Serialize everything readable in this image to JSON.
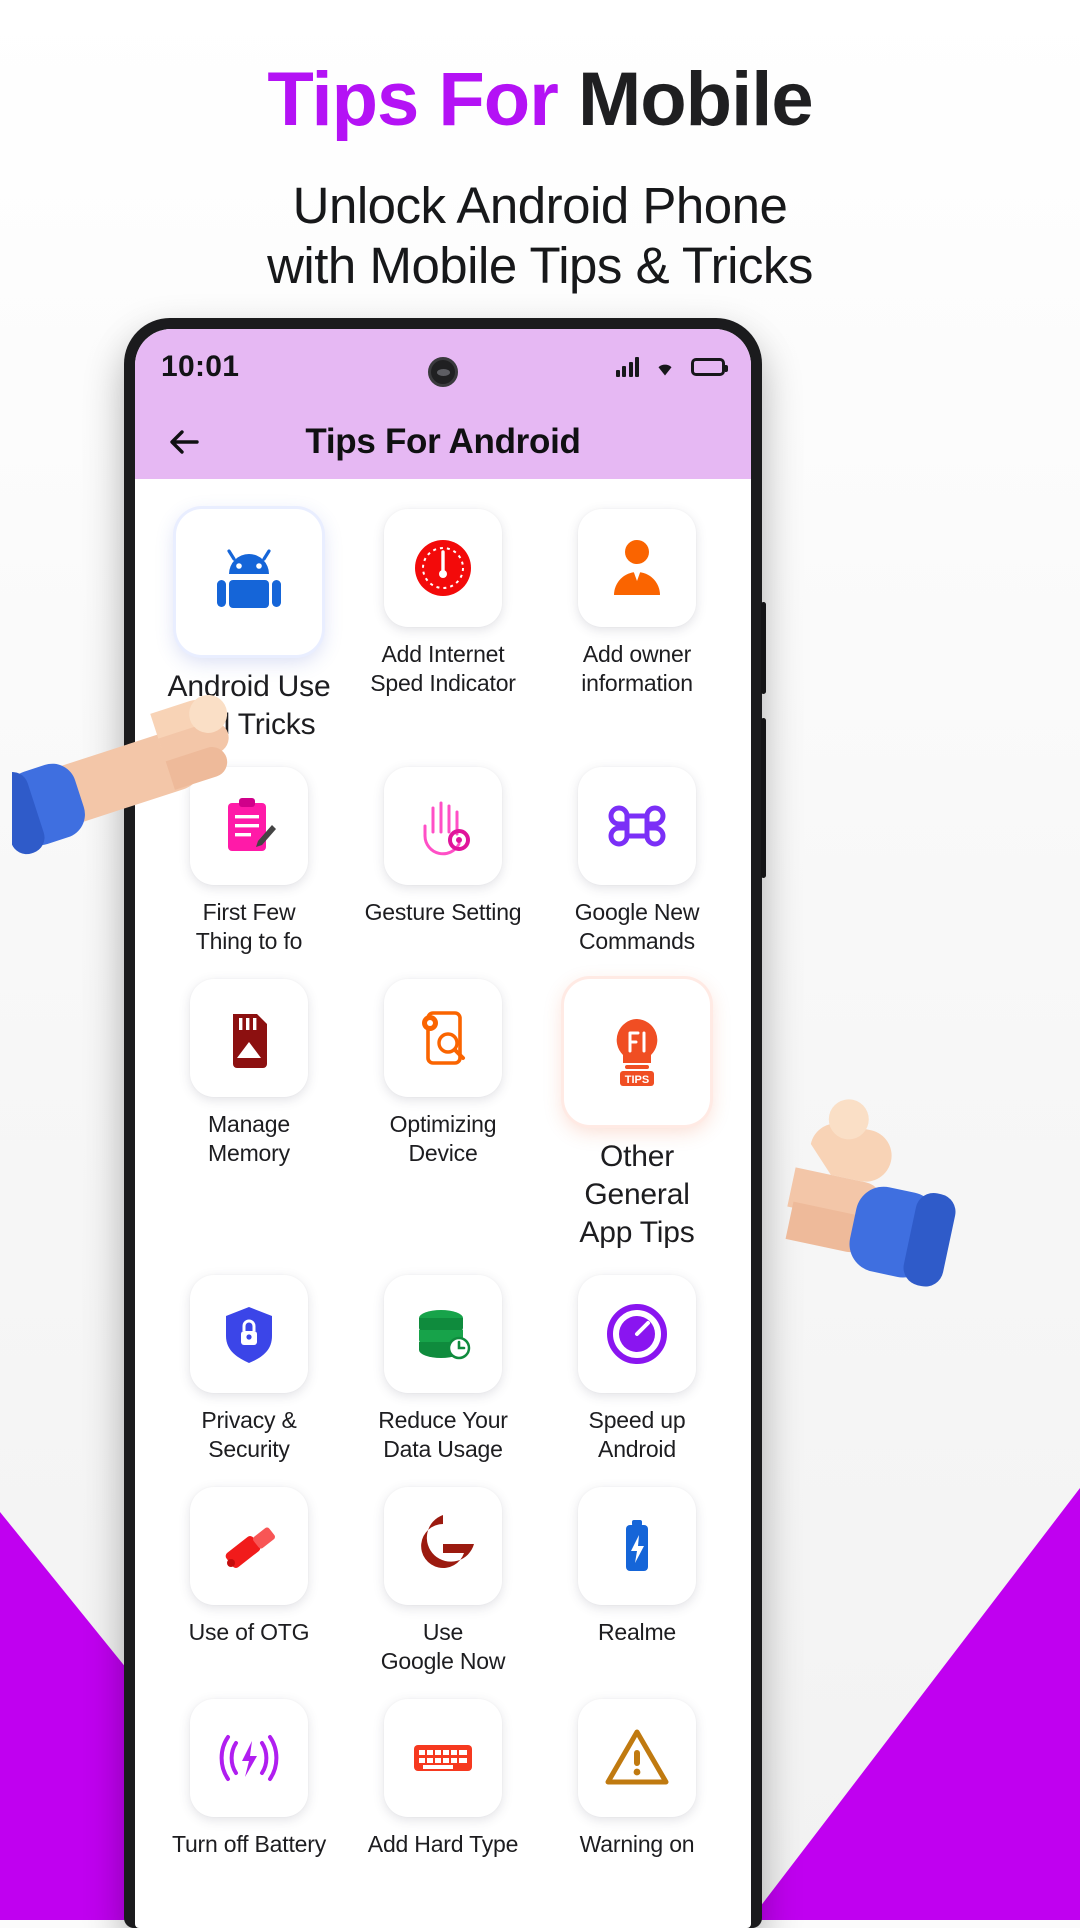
{
  "promo": {
    "title_accent": "Tips For",
    "title_rest": "Mobile",
    "subtitle_line1": "Unlock Android Phone",
    "subtitle_line2": "with Mobile Tips & Tricks",
    "accent_color": "#b412f5",
    "corner_color": "#c000f0"
  },
  "phone": {
    "statusbar": {
      "clock": "10:01",
      "signal_icon": "signal-bars-icon",
      "wifi_icon": "wifi-icon",
      "battery_icon": "battery-icon",
      "camera_icon": "front-camera-punch-hole",
      "bg_color": "#e6b8f3"
    },
    "appbar": {
      "back_icon": "back-arrow-icon",
      "title": "Tips For Android",
      "bg_color": "#e6b8f3"
    },
    "grid": {
      "items": [
        {
          "label": "Android Use\nFull Tricks",
          "icon": "android-robot-icon",
          "highlight": "blue"
        },
        {
          "label": "Add Internet\nSped Indicator",
          "icon": "speedometer-icon",
          "highlight": ""
        },
        {
          "label": "Add owner\ninformation",
          "icon": "owner-person-icon",
          "highlight": ""
        },
        {
          "label": "First Few\nThing to fo",
          "icon": "checklist-clipboard-icon",
          "highlight": ""
        },
        {
          "label": "Gesture Setting",
          "icon": "hand-gesture-icon",
          "highlight": ""
        },
        {
          "label": "Google New\nCommands",
          "icon": "command-key-icon",
          "highlight": ""
        },
        {
          "label": "Manage\nMemory",
          "icon": "sd-card-icon",
          "highlight": ""
        },
        {
          "label": "Optimizing\nDevice",
          "icon": "device-optimize-icon",
          "highlight": ""
        },
        {
          "label": "Other General\nApp Tips",
          "icon": "lightbulb-tips-icon",
          "highlight": "red"
        },
        {
          "label": "Privacy &\nSecurity",
          "icon": "shield-lock-icon",
          "highlight": ""
        },
        {
          "label": "Reduce Your\nData Usage",
          "icon": "database-clock-icon",
          "highlight": ""
        },
        {
          "label": "Speed up\nAndroid",
          "icon": "speed-gauge-icon",
          "highlight": ""
        },
        {
          "label": "Use of OTG",
          "icon": "otg-usb-icon",
          "highlight": ""
        },
        {
          "label": "Use\nGoogle Now",
          "icon": "google-g-icon",
          "highlight": ""
        },
        {
          "label": "Realme",
          "icon": "battery-bolt-icon",
          "highlight": ""
        },
        {
          "label": "Turn off Battery",
          "icon": "wireless-power-icon",
          "highlight": ""
        },
        {
          "label": "Add Hard Type",
          "icon": "keyboard-icon",
          "highlight": ""
        },
        {
          "label": "Warning on",
          "icon": "warning-triangle-icon",
          "highlight": ""
        }
      ]
    }
  },
  "pointers": [
    {
      "name": "hand-pointer-left",
      "target_label": "Android Use Full Tricks"
    },
    {
      "name": "hand-pointer-right",
      "target_label": "Other General App Tips"
    }
  ]
}
